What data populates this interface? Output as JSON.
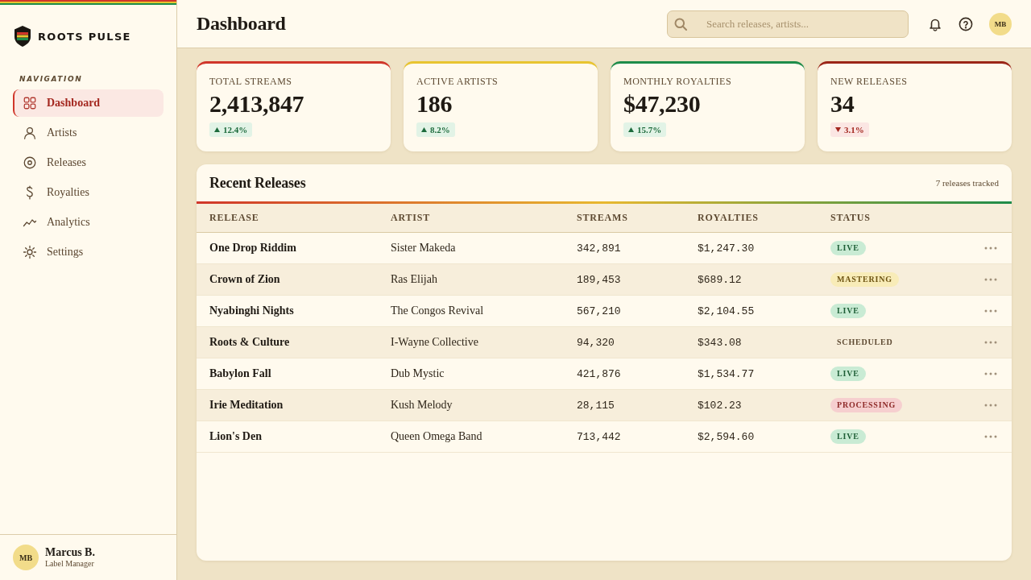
{
  "brand": {
    "name": "ROOTS PULSE"
  },
  "sidebar": {
    "section_title": "NAVIGATION",
    "items": [
      {
        "label": "Dashboard",
        "selected": true
      },
      {
        "label": "Artists",
        "selected": false
      },
      {
        "label": "Releases",
        "selected": false
      },
      {
        "label": "Royalties",
        "selected": false
      },
      {
        "label": "Analytics",
        "selected": false
      },
      {
        "label": "Settings",
        "selected": false
      }
    ],
    "user": {
      "initials": "MB",
      "name": "Marcus B.",
      "role": "Label Manager"
    }
  },
  "header": {
    "title": "Dashboard",
    "search": {
      "placeholder": "Search releases, artists..."
    },
    "avatar": {
      "initials": "MB"
    }
  },
  "stats": [
    {
      "label": "TOTAL STREAMS",
      "value": "2,413,847",
      "change": "12.4%",
      "increase": true,
      "color": "#d0362a"
    },
    {
      "label": "ACTIVE ARTISTS",
      "value": "186",
      "change": "8.2%",
      "increase": true,
      "color": "#e8c430"
    },
    {
      "label": "MONTHLY ROYALTIES",
      "value": "$47,230",
      "change": "15.7%",
      "increase": true,
      "color": "#1e8c4a"
    },
    {
      "label": "NEW RELEASES",
      "value": "34",
      "change": "3.1%",
      "increase": false,
      "color": "#9b2618"
    }
  ],
  "releases": {
    "title": "Recent Releases",
    "count": "7 releases tracked",
    "columns": [
      "RELEASE",
      "ARTIST",
      "STREAMS",
      "ROYALTIES",
      "STATUS"
    ],
    "rows": [
      {
        "release": "One Drop Riddim",
        "artist": "Sister Makeda",
        "streams": "342,891",
        "royalties": "$1,247.30",
        "status": {
          "label": "LIVE",
          "kind": "live"
        }
      },
      {
        "release": "Crown of Zion",
        "artist": "Ras Elijah",
        "streams": "189,453",
        "royalties": "$689.12",
        "status": {
          "label": "MASTERING",
          "kind": "mastering"
        }
      },
      {
        "release": "Nyabinghi Nights",
        "artist": "The Congos Revival",
        "streams": "567,210",
        "royalties": "$2,104.55",
        "status": {
          "label": "LIVE",
          "kind": "live"
        }
      },
      {
        "release": "Roots & Culture",
        "artist": "I-Wayne Collective",
        "streams": "94,320",
        "royalties": "$343.08",
        "status": {
          "label": "SCHEDULED",
          "kind": "scheduled"
        }
      },
      {
        "release": "Babylon Fall",
        "artist": "Dub Mystic",
        "streams": "421,876",
        "royalties": "$1,534.77",
        "status": {
          "label": "LIVE",
          "kind": "live"
        }
      },
      {
        "release": "Irie Meditation",
        "artist": "Kush Melody",
        "streams": "28,115",
        "royalties": "$102.23",
        "status": {
          "label": "PROCESSING",
          "kind": "processing"
        }
      },
      {
        "release": "Lion's Den",
        "artist": "Queen Omega Band",
        "streams": "713,442",
        "royalties": "$2,594.60",
        "status": {
          "label": "LIVE",
          "kind": "live"
        }
      }
    ]
  }
}
